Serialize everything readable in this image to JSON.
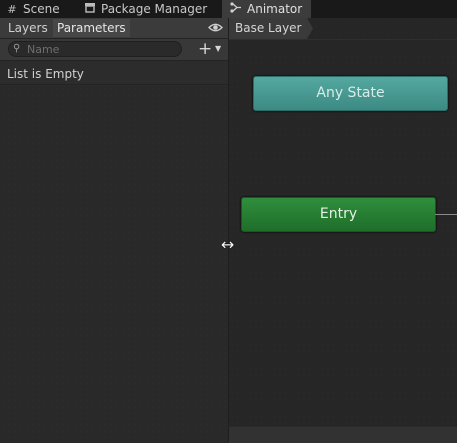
{
  "tabs": [
    {
      "label": "Scene",
      "icon": "grid-icon"
    },
    {
      "label": "Package Manager",
      "icon": "package-icon"
    },
    {
      "label": "Animator",
      "icon": "animator-icon",
      "active": true
    }
  ],
  "left_panel": {
    "subtabs": [
      {
        "label": "Layers",
        "active": false
      },
      {
        "label": "Parameters",
        "active": true
      }
    ],
    "search": {
      "placeholder": "Name",
      "value": ""
    },
    "add_button": {
      "label": "+"
    },
    "empty_text": "List is Empty"
  },
  "graph": {
    "breadcrumb": "Base Layer",
    "nodes": [
      {
        "label": "Any State",
        "color": "#4a9c94"
      },
      {
        "label": "Entry",
        "color": "#29803a"
      }
    ]
  },
  "colors": {
    "background": "#282828",
    "tabbar": "#191919",
    "panel_header": "#3b3b3b"
  }
}
